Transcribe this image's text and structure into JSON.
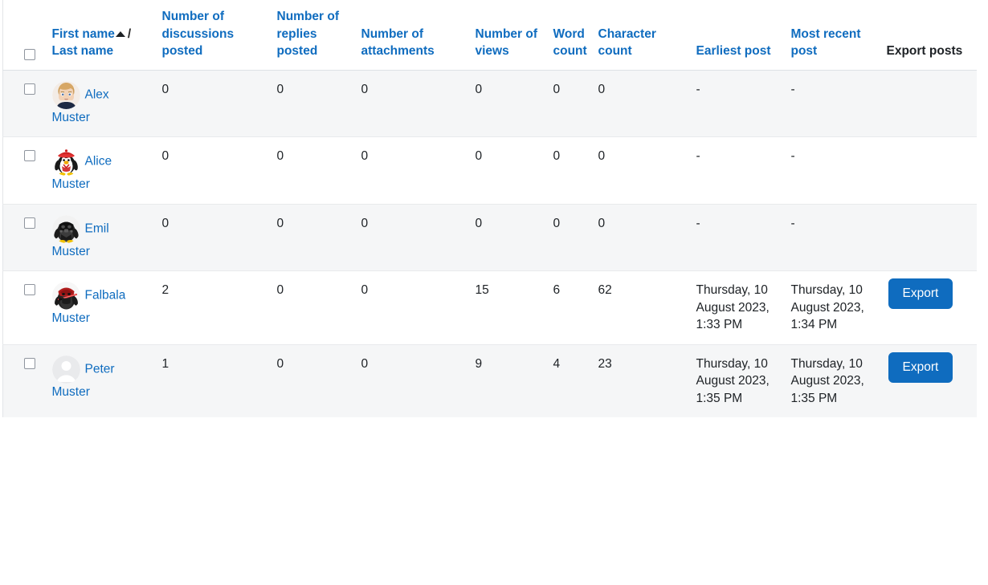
{
  "table": {
    "sort": {
      "column": "First name",
      "direction": "asc",
      "icon": "sort-asc-arrow-icon"
    },
    "headers": {
      "select_all": "",
      "name": {
        "first": "First name",
        "separator": "/",
        "last": "Last name"
      },
      "discussions": "Number of discussions posted",
      "replies": "Number of replies posted",
      "attachments": "Number of attachments",
      "views": "Number of views",
      "word_count": "Word count",
      "char_count": "Character count",
      "earliest_post": "Earliest post",
      "most_recent_post": "Most recent post",
      "export_posts": "Export posts"
    },
    "rows": [
      {
        "avatar": "anime-blonde-avatar",
        "first_name": "Alex",
        "last_name": "Muster",
        "discussions": "0",
        "replies": "0",
        "attachments": "0",
        "views": "0",
        "word_count": "0",
        "char_count": "0",
        "earliest_post": "-",
        "most_recent_post": "-",
        "export_label": "",
        "has_export": false,
        "selected": false
      },
      {
        "avatar": "penguin-red-beret-avatar",
        "first_name": "Alice",
        "last_name": "Muster",
        "discussions": "0",
        "replies": "0",
        "attachments": "0",
        "views": "0",
        "word_count": "0",
        "char_count": "0",
        "earliest_post": "-",
        "most_recent_post": "-",
        "export_label": "",
        "has_export": false,
        "selected": false
      },
      {
        "avatar": "penguin-dark-vader-avatar",
        "first_name": "Emil",
        "last_name": "Muster",
        "discussions": "0",
        "replies": "0",
        "attachments": "0",
        "views": "0",
        "word_count": "0",
        "char_count": "0",
        "earliest_post": "-",
        "most_recent_post": "-",
        "export_label": "",
        "has_export": false,
        "selected": false
      },
      {
        "avatar": "penguin-red-sith-avatar",
        "first_name": "Falbala",
        "last_name": "Muster",
        "discussions": "2",
        "replies": "0",
        "attachments": "0",
        "views": "15",
        "word_count": "6",
        "char_count": "62",
        "earliest_post": "Thursday, 10 August 2023, 1:33 PM",
        "most_recent_post": "Thursday, 10 August 2023, 1:34 PM",
        "export_label": "Export",
        "has_export": true,
        "selected": false
      },
      {
        "avatar": "default-user-avatar",
        "first_name": "Peter",
        "last_name": "Muster",
        "discussions": "1",
        "replies": "0",
        "attachments": "0",
        "views": "9",
        "word_count": "4",
        "char_count": "23",
        "earliest_post": "Thursday, 10 August 2023, 1:35 PM",
        "most_recent_post": "Thursday, 10 August 2023, 1:35 PM",
        "export_label": "Export",
        "has_export": true,
        "selected": false
      }
    ]
  },
  "colors": {
    "link": "#0f6cbf",
    "text": "#1d2125",
    "button": "#0f6cbf",
    "row_stripe": "#f5f6f7",
    "border": "#dee2e6"
  }
}
